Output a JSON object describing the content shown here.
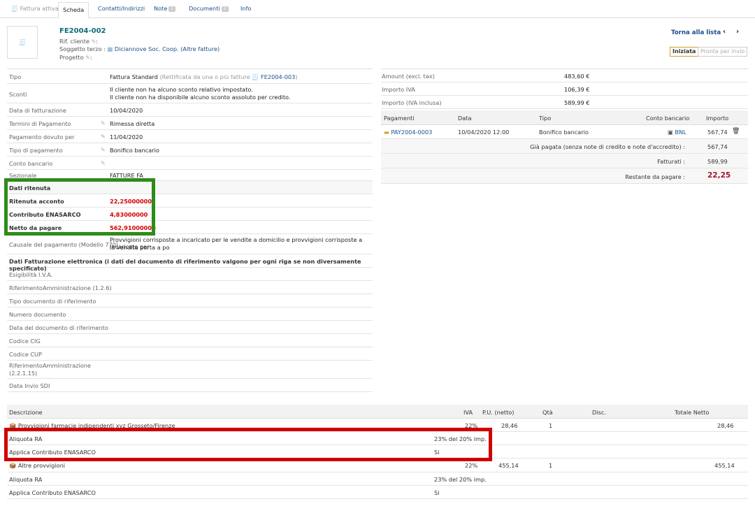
{
  "tabs": [
    {
      "label": "Fattura attiva"
    },
    {
      "label": "Scheda"
    },
    {
      "label": "Contatti/Indirizzi"
    },
    {
      "label": "Note",
      "badge": "1"
    },
    {
      "label": "Documenti",
      "badge": "2"
    },
    {
      "label": "Info"
    }
  ],
  "header": {
    "ref": "FE2004-002",
    "rif_cliente_label": "Rif. cliente",
    "soggetto_label": "Soggetto terzo :",
    "soggetto_value": "Diciannove Soc. Coop. (Altre fatture)",
    "progetto_label": "Progetto",
    "back_label": "Torna alla lista",
    "status_current": "Iniziata",
    "status_next": "Pronta per invio"
  },
  "left": {
    "tipo_label": "Tipo",
    "tipo_value": "Fattura Standard",
    "tipo_note": "(Rettificata da una o più fatture",
    "tipo_ref": "FE2004-003",
    "tipo_close": ")",
    "sconti_label": "Sconti",
    "sconti_1": "Il cliente non ha alcuno sconto relativo impostato.",
    "sconti_2": "Il cliente non ha disponibile alcuno sconto assoluto per credito.",
    "data_label": "Data di fatturazione",
    "data_value": "10/04/2020",
    "termini_label": "Termini di Pagamento",
    "termini_value": "Rimessa diretta",
    "dovuto_label": "Pagamento dovuto per",
    "dovuto_value": "11/04/2020",
    "tipopag_label": "Tipo di pagamento",
    "tipopag_value": "Bonifico bancario",
    "conto_label": "Conto bancario",
    "sezionale_label": "Sezionale",
    "sezionale_value": "FATTURE FA",
    "ritenuta_title": "Dati ritenuta",
    "ritenuta_label": "Ritenuta acconto",
    "ritenuta_value": "22,25000000",
    "enasarco_label": "Contributo ENASARCO",
    "enasarco_value": "4,83000000",
    "netto_label": "Netto da pagare",
    "netto_value": "562,91000000",
    "causale_label": "Causale del pagamento (Modello 770)",
    "causale_value_1": "Provvigioni corrisposte a incaricato per le vendite a domicilio e provvigioni corrisposte a incaricato per",
    "causale_value_2": "la vendita porta a po",
    "fe_title": "Dati Fatturazione elettronica (i dati del documento di riferimento valgono per ogni riga se non diversamente specificato)",
    "fe_rows": [
      "Esigibilità I.V.A.",
      "RiferimentoAmministrazione (1.2.6)",
      "Tipo documento di riferimento",
      "Numero documento",
      "Data del documento di riferimento",
      "Codice CIG",
      "Codice CUP"
    ],
    "rifamm_1": "RiferimentoAmministrazione",
    "rifamm_2": "(2.2.1.15)",
    "invio_label": "Data Invio SDI"
  },
  "right": {
    "amount_label": "Amount (excl. tax)",
    "amount_value": "483,60 €",
    "iva_label": "Importo IVA",
    "iva_value": "106,39 €",
    "totale_label": "Importo (IVA inclusa)",
    "totale_value": "589,99 €",
    "pay_headers": {
      "pagamenti": "Pagamenti",
      "data": "Data",
      "tipo": "Tipo",
      "conto": "Conto bancario",
      "importo": "Importo"
    },
    "payment": {
      "ref": "PAY2004-0003",
      "data": "10/04/2020 12:00",
      "tipo": "Bonifico bancario",
      "conto": "BNL",
      "importo": "567,74"
    },
    "gia_label": "Già pagata (senza note di credito e note d'accredito) :",
    "gia_value": "567,74",
    "fatturati_label": "Fatturati :",
    "fatturati_value": "589,99",
    "restante_label": "Restante da pagare :",
    "restante_value": "22,25"
  },
  "lines": {
    "headers": {
      "descrizione": "Descrizione",
      "iva": "IVA",
      "pu": "P.U. (netto)",
      "qta": "Qtà",
      "disc": "Disc.",
      "totale": "Totale Netto"
    },
    "items": [
      {
        "desc": "Provvigioni farmacie indipendenti xyz Grosseto/Firenze",
        "iva": "22%",
        "pu": "28,46",
        "qta": "1",
        "totale": "28,46",
        "ra_label": "Aliquota RA",
        "ra_value": "23% del 20% imp.",
        "ena_label": "Applica Contributo ENASARCO",
        "ena_value": "Si"
      },
      {
        "desc": "Altre provvigioni",
        "iva": "22%",
        "pu": "455,14",
        "qta": "1",
        "totale": "455,14",
        "ra_label": "Aliquota RA",
        "ra_value": "23% del 20% imp.",
        "ena_label": "Applica Contributo ENASARCO",
        "ena_value": "Si"
      }
    ]
  }
}
